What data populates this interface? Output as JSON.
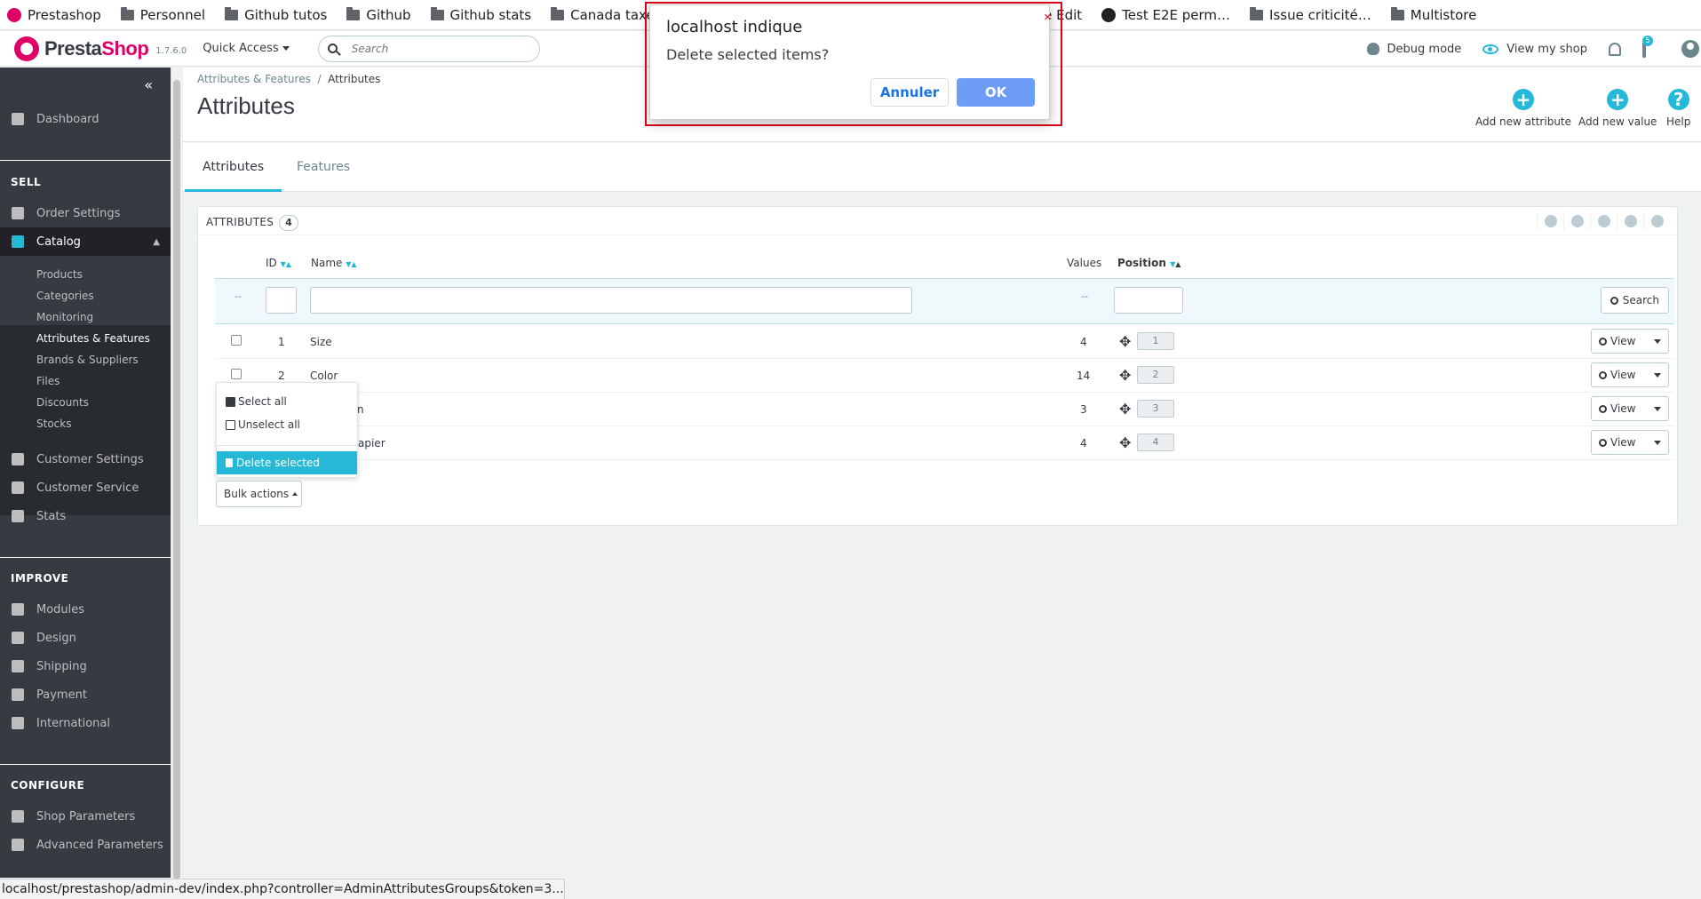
{
  "bookmarks": [
    {
      "label": "Prestashop",
      "icon": "prestashop-icon"
    },
    {
      "label": "Personnel",
      "icon": "folder-icon"
    },
    {
      "label": "Github tutos",
      "icon": "folder-icon"
    },
    {
      "label": "Github",
      "icon": "folder-icon"
    },
    {
      "label": "Github stats",
      "icon": "folder-icon"
    },
    {
      "label": "Canada taxes",
      "icon": "folder-icon"
    },
    {
      "label": "PR Live Edit",
      "icon": "github-icon"
    },
    {
      "label": "Test E2E perm…",
      "icon": "github-icon"
    },
    {
      "label": "Issue criticité…",
      "icon": "folder-icon"
    },
    {
      "label": "Multistore",
      "icon": "folder-icon"
    }
  ],
  "header": {
    "logo_presta": "Presta",
    "logo_shop": "Shop",
    "version": "1.7.6.0",
    "quick_access": "Quick Access",
    "search_placeholder": "Search",
    "debug_mode": "Debug mode",
    "view_shop": "View my shop",
    "cart_badge": "5"
  },
  "sidebar": {
    "dashboard": "Dashboard",
    "sell_title": "SELL",
    "order_settings": "Order Settings",
    "catalog": "Catalog",
    "catalog_sub": [
      "Products",
      "Categories",
      "Monitoring",
      "Attributes & Features",
      "Brands & Suppliers",
      "Files",
      "Discounts",
      "Stocks"
    ],
    "customer_settings": "Customer Settings",
    "customer_service": "Customer Service",
    "stats": "Stats",
    "improve_title": "IMPROVE",
    "modules": "Modules",
    "design": "Design",
    "shipping": "Shipping",
    "payment": "Payment",
    "international": "International",
    "configure_title": "CONFIGURE",
    "shop_parameters": "Shop Parameters",
    "advanced_parameters": "Advanced Parameters"
  },
  "page": {
    "breadcrumb_parent": "Attributes & Features",
    "breadcrumb_sep": "/",
    "breadcrumb_current": "Attributes",
    "title": "Attributes",
    "toolbar": {
      "add_attribute": "Add new attribute",
      "add_value": "Add new value",
      "help": "Help",
      "help_symbol": "?",
      "plus_symbol": "+"
    },
    "tabs": [
      "Attributes",
      "Features"
    ]
  },
  "list": {
    "title": "ATTRIBUTES",
    "count": "4",
    "columns": {
      "id": "ID",
      "name": "Name",
      "values": "Values",
      "position": "Position"
    },
    "filter_dash": "--",
    "search_button": "Search",
    "rows": [
      {
        "id": "1",
        "name": "Size",
        "values": "4",
        "position": "1"
      },
      {
        "id": "2",
        "name": "Color",
        "values": "14",
        "position": "2"
      },
      {
        "id": "",
        "name": "n",
        "values": "3",
        "position": "3"
      },
      {
        "id": "",
        "name": "apier",
        "values": "4",
        "position": "4"
      }
    ],
    "view_label": "View",
    "bulk_menu": {
      "select_all": "Select all",
      "unselect_all": "Unselect all",
      "delete_selected": "Delete selected"
    },
    "bulk_actions": "Bulk actions"
  },
  "status_url": "localhost/prestashop/admin-dev/index.php?controller=AdminAttributesGroups&token=3...",
  "dialog": {
    "title": "localhost indique",
    "message": "Delete selected items?",
    "cancel": "Annuler",
    "ok": "OK"
  }
}
